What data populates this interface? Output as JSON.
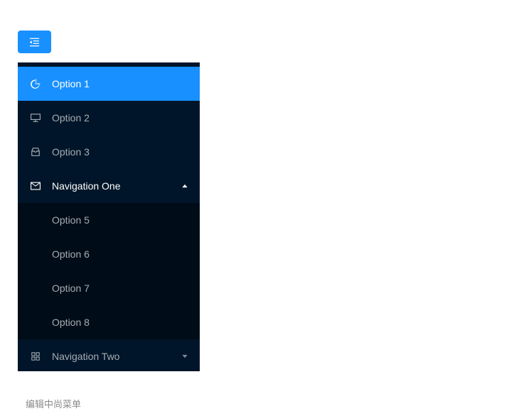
{
  "colors": {
    "accent": "#1890ff",
    "sidebar_bg": "#001529",
    "submenu_bg": "#000c17",
    "menu_text": "#a6adb4",
    "active_text": "#ffffff",
    "page_bg": "#ffffff",
    "caption_text": "#8a8a8a"
  },
  "toggle": {
    "icon": "menu-fold-icon",
    "label": ""
  },
  "sidebar": {
    "items": [
      {
        "label": "Option 1",
        "icon": "pie-chart-icon",
        "active": true,
        "type": "item"
      },
      {
        "label": "Option 2",
        "icon": "desktop-icon",
        "active": false,
        "type": "item"
      },
      {
        "label": "Option 3",
        "icon": "inbox-icon",
        "active": false,
        "type": "item"
      },
      {
        "label": "Navigation One",
        "icon": "mail-icon",
        "arrow": "chevron-up-icon",
        "expanded": true,
        "type": "submenu",
        "children": [
          {
            "label": "Option 5"
          },
          {
            "label": "Option 6"
          },
          {
            "label": "Option 7"
          },
          {
            "label": "Option 8"
          }
        ]
      },
      {
        "label": "Navigation Two",
        "icon": "appstore-grid-icon",
        "arrow": "chevron-down-icon",
        "expanded": false,
        "type": "submenu",
        "children": []
      }
    ]
  },
  "caption": {
    "text": "编辑中尚菜单"
  }
}
